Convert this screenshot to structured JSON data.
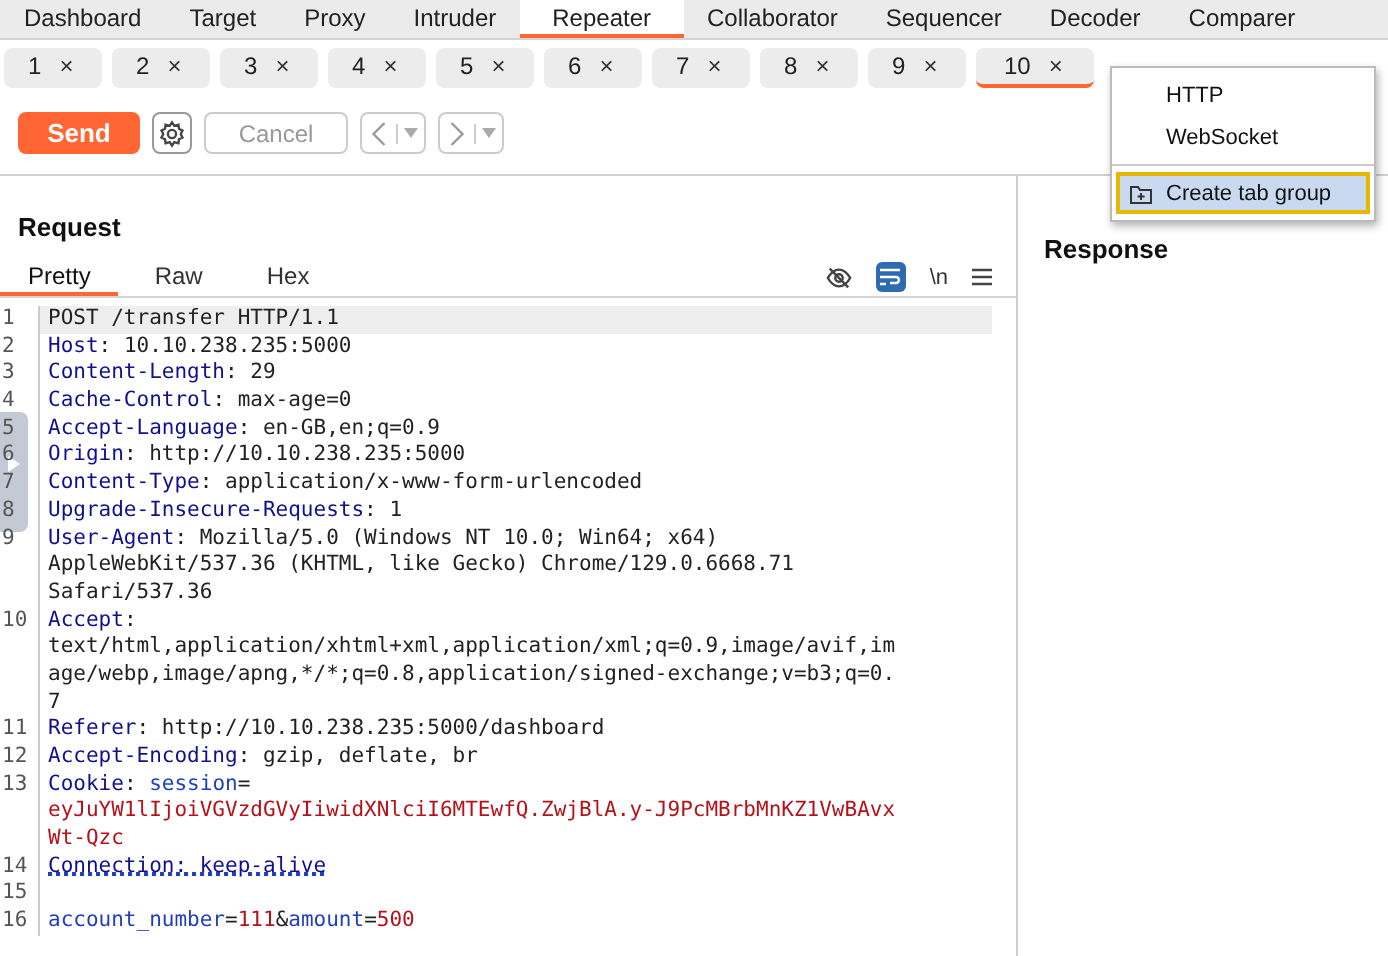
{
  "main_tabs": [
    {
      "label": "Dashboard",
      "selected": false
    },
    {
      "label": "Target",
      "selected": false
    },
    {
      "label": "Proxy",
      "selected": false
    },
    {
      "label": "Intruder",
      "selected": false
    },
    {
      "label": "Repeater",
      "selected": true
    },
    {
      "label": "Collaborator",
      "selected": false
    },
    {
      "label": "Sequencer",
      "selected": false
    },
    {
      "label": "Decoder",
      "selected": false
    },
    {
      "label": "Comparer",
      "selected": false
    }
  ],
  "repeater_tabs": [
    {
      "label": "1",
      "selected": false
    },
    {
      "label": "2",
      "selected": false
    },
    {
      "label": "3",
      "selected": false
    },
    {
      "label": "4",
      "selected": false
    },
    {
      "label": "5",
      "selected": false
    },
    {
      "label": "6",
      "selected": false
    },
    {
      "label": "7",
      "selected": false
    },
    {
      "label": "8",
      "selected": false
    },
    {
      "label": "9",
      "selected": false
    },
    {
      "label": "10",
      "selected": true
    }
  ],
  "close_mark": "×",
  "toolbar": {
    "send": "Send",
    "cancel": "Cancel",
    "cancel_disabled": true
  },
  "request": {
    "title": "Request",
    "view_tabs": [
      {
        "label": "Pretty",
        "selected": true
      },
      {
        "label": "Raw",
        "selected": false
      },
      {
        "label": "Hex",
        "selected": false
      }
    ],
    "wrap_on": true,
    "newline_toggle": "\\n",
    "lines": [
      {
        "number": "1",
        "current": true,
        "rows": [
          [
            {
              "t": "POST /transfer HTTP/1.1",
              "kind": "plain"
            }
          ]
        ]
      },
      {
        "number": "2",
        "current": false,
        "rows": [
          [
            {
              "t": "Host",
              "kind": "name"
            },
            {
              "t": ": 10.10.238.235:5000",
              "kind": "plain"
            }
          ]
        ]
      },
      {
        "number": "3",
        "current": false,
        "rows": [
          [
            {
              "t": "Content-Length",
              "kind": "name"
            },
            {
              "t": ": 29",
              "kind": "plain"
            }
          ]
        ]
      },
      {
        "number": "4",
        "current": false,
        "rows": [
          [
            {
              "t": "Cache-Control",
              "kind": "name"
            },
            {
              "t": ": max-age=0",
              "kind": "plain"
            }
          ]
        ]
      },
      {
        "number": "5",
        "current": false,
        "rows": [
          [
            {
              "t": "Accept-Language",
              "kind": "name"
            },
            {
              "t": ": en-GB,en;q=0.9",
              "kind": "plain"
            }
          ]
        ]
      },
      {
        "number": "6",
        "current": false,
        "rows": [
          [
            {
              "t": "Origin",
              "kind": "name"
            },
            {
              "t": ": http://10.10.238.235:5000",
              "kind": "plain"
            }
          ]
        ]
      },
      {
        "number": "7",
        "current": false,
        "rows": [
          [
            {
              "t": "Content-Type",
              "kind": "name"
            },
            {
              "t": ": application/x-www-form-urlencoded",
              "kind": "plain"
            }
          ]
        ]
      },
      {
        "number": "8",
        "current": false,
        "rows": [
          [
            {
              "t": "Upgrade-Insecure-Requests",
              "kind": "name"
            },
            {
              "t": ": 1",
              "kind": "plain"
            }
          ]
        ]
      },
      {
        "number": "9",
        "current": false,
        "rows": [
          [
            {
              "t": "User-Agent",
              "kind": "name"
            },
            {
              "t": ": Mozilla/5.0 (Windows NT 10.0; Win64; x64)",
              "kind": "plain"
            }
          ],
          [
            {
              "t": "AppleWebKit/537.36 (KHTML, like Gecko) Chrome/129.0.6668.71",
              "kind": "plain"
            }
          ],
          [
            {
              "t": "Safari/537.36",
              "kind": "plain"
            }
          ]
        ]
      },
      {
        "number": "10",
        "current": false,
        "rows": [
          [
            {
              "t": "Accept",
              "kind": "name"
            },
            {
              "t": ":",
              "kind": "plain"
            }
          ],
          [
            {
              "t": "text/html,application/xhtml+xml,application/xml;q=0.9,image/avif,im",
              "kind": "plain"
            }
          ],
          [
            {
              "t": "age/webp,image/apng,*/*;q=0.8,application/signed-exchange;v=b3;q=0.",
              "kind": "plain"
            }
          ],
          [
            {
              "t": "7",
              "kind": "plain"
            }
          ]
        ]
      },
      {
        "number": "11",
        "current": false,
        "rows": [
          [
            {
              "t": "Referer",
              "kind": "name"
            },
            {
              "t": ": http://10.10.238.235:5000/dashboard",
              "kind": "plain"
            }
          ]
        ]
      },
      {
        "number": "12",
        "current": false,
        "rows": [
          [
            {
              "t": "Accept-Encoding",
              "kind": "name"
            },
            {
              "t": ": gzip, deflate, br",
              "kind": "plain"
            }
          ]
        ]
      },
      {
        "number": "13",
        "current": false,
        "rows": [
          [
            {
              "t": "Cookie",
              "kind": "name"
            },
            {
              "t": ": ",
              "kind": "plain"
            },
            {
              "t": "session",
              "kind": "param"
            },
            {
              "t": "=",
              "kind": "plain"
            }
          ],
          [
            {
              "t": "eyJuYW1lIjoiVGVzdGVyIiwidXNlciI6MTEwfQ.ZwjBlA.y-J9PcMBrbMnKZ1VwBAvx",
              "kind": "value"
            }
          ],
          [
            {
              "t": "Wt-Qzc",
              "kind": "value"
            }
          ]
        ]
      },
      {
        "number": "14",
        "current": false,
        "rows": [
          [
            {
              "t": "Connection: keep-alive",
              "kind": "flagged"
            }
          ]
        ]
      },
      {
        "number": "15",
        "current": false,
        "rows": [
          []
        ]
      },
      {
        "number": "16",
        "current": false,
        "rows": [
          [
            {
              "t": "account_number",
              "kind": "param"
            },
            {
              "t": "=",
              "kind": "plain"
            },
            {
              "t": "111",
              "kind": "value"
            },
            {
              "t": "&",
              "kind": "plain"
            },
            {
              "t": "amount",
              "kind": "param"
            },
            {
              "t": "=",
              "kind": "plain"
            },
            {
              "t": "500",
              "kind": "value"
            }
          ]
        ]
      }
    ]
  },
  "response": {
    "title": "Response"
  },
  "new_tab_menu": {
    "items": [
      {
        "label": "HTTP",
        "kind": "item",
        "highlighted": false
      },
      {
        "label": "WebSocket",
        "kind": "item",
        "highlighted": false
      },
      {
        "label": "Create tab group",
        "kind": "group",
        "highlighted": true
      }
    ]
  }
}
